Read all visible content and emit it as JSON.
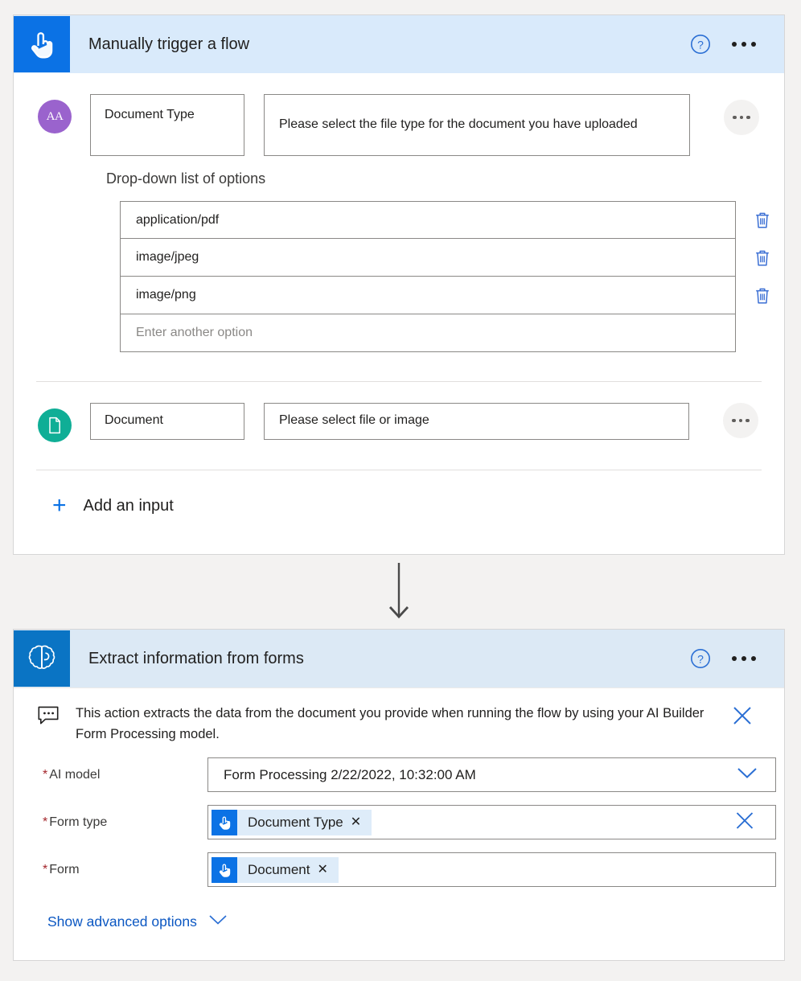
{
  "trigger_card": {
    "title": "Manually trigger a flow",
    "icon": "touch-trigger-icon",
    "help_icon": "help-circle-icon",
    "more_icon": "more-menu-icon",
    "inputs": [
      {
        "avatar_icon": "text-type-icon",
        "avatar_text": "AA",
        "title": "Document Type",
        "description": "Please select the file type for the document you have uploaded",
        "more_icon": "more-menu-icon",
        "options_label": "Drop-down list of options",
        "options": [
          "application/pdf",
          "image/jpeg",
          "image/png"
        ],
        "new_option_placeholder": "Enter another option",
        "delete_icon": "trash-icon"
      },
      {
        "avatar_icon": "file-type-icon",
        "title": "Document",
        "description": "Please select file or image",
        "more_icon": "more-menu-icon"
      }
    ],
    "add_input": {
      "label": "Add an input",
      "icon": "plus-icon"
    }
  },
  "connector": {
    "icon": "arrow-down-icon"
  },
  "action_card": {
    "title": "Extract information from forms",
    "icon": "ai-builder-brain-icon",
    "help_icon": "help-circle-icon",
    "more_icon": "more-menu-icon",
    "info_banner": {
      "icon": "speech-bubble-icon",
      "text": "This action extracts the data from the document you provide when running the flow by using your AI Builder Form Processing model.",
      "close_icon": "close-icon"
    },
    "parameters": [
      {
        "label": "AI model",
        "required": true,
        "value": "Form Processing 2/22/2022, 10:32:00 AM",
        "control": "dropdown",
        "chevron_icon": "chevron-down-icon"
      },
      {
        "label": "Form type",
        "required": true,
        "token": "Document Type",
        "token_icon": "touch-trigger-icon",
        "token_remove_icon": "token-remove-icon",
        "control": "token",
        "clear_icon": "clear-icon"
      },
      {
        "label": "Form",
        "required": true,
        "token": "Document",
        "token_icon": "touch-trigger-icon",
        "token_remove_icon": "token-remove-icon",
        "control": "token"
      }
    ],
    "advanced": {
      "label": "Show advanced options",
      "icon": "chevron-down-icon"
    }
  },
  "colors": {
    "trigger_blue": "#0b72e5",
    "action_blue": "#0a74c4",
    "header_tint": "#d9eafb",
    "purple_avatar": "#9a63cd",
    "teal_avatar": "#0fae96",
    "link_blue": "#0b57c2",
    "required_red": "#a4262c",
    "page_bg": "#f3f2f1"
  }
}
